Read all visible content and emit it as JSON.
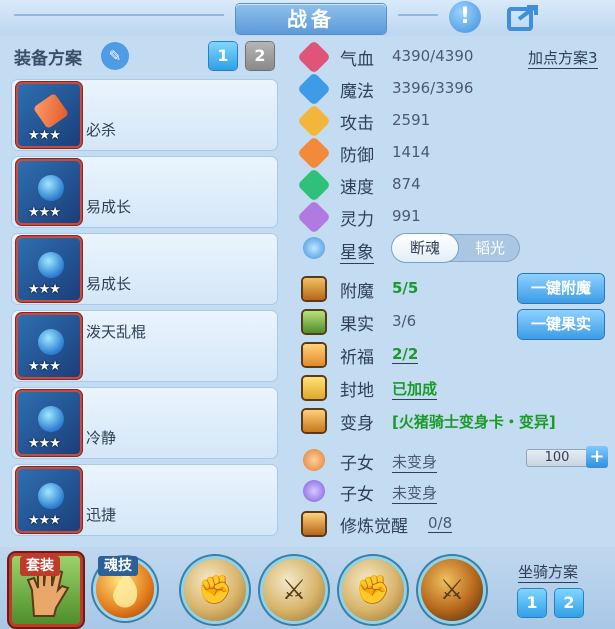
{
  "title": "战备",
  "left": {
    "plan_label": "装备方案",
    "plan_tabs": [
      "1",
      "2"
    ],
    "equipment": [
      {
        "name": "必杀",
        "stars": "★★★"
      },
      {
        "name": "易成长",
        "stars": "★★★"
      },
      {
        "name": "易成长",
        "stars": "★★★"
      },
      {
        "name": "泼天乱棍",
        "stars": "★★★"
      },
      {
        "name": "冷静",
        "stars": "★★★"
      },
      {
        "name": "迅捷",
        "stars": "★★★"
      }
    ]
  },
  "stats": {
    "points_plan": "加点方案3",
    "rows": [
      {
        "label": "气血",
        "value": "4390/4390",
        "color": "#e0547a",
        "icon": "heart-icon"
      },
      {
        "label": "魔法",
        "value": "3396/3396",
        "color": "#3e9be8",
        "icon": "shield-icon"
      },
      {
        "label": "攻击",
        "value": "2591",
        "color": "#f2b73a",
        "icon": "sword-icon"
      },
      {
        "label": "防御",
        "value": "1414",
        "color": "#f28a3a",
        "icon": "armor-icon"
      },
      {
        "label": "速度",
        "value": "874",
        "color": "#2fc07a",
        "icon": "lightning-icon"
      },
      {
        "label": "灵力",
        "value": "991",
        "color": "#b07be0",
        "icon": "spirit-icon"
      }
    ],
    "star_label": "星象",
    "star_options": [
      "断魂",
      "韬光"
    ]
  },
  "extras": [
    {
      "label": "附魔",
      "value": "5/5",
      "green": true,
      "button": "一键附魔"
    },
    {
      "label": "果实",
      "value": "3/6",
      "green": false,
      "button": "一键果实"
    },
    {
      "label": "祈福",
      "value": "2/2",
      "green": true
    },
    {
      "label": "封地",
      "value": "已加成",
      "green": true
    },
    {
      "label": "变身",
      "value": "[火猪骑士变身卡・变异]",
      "green": true
    },
    {
      "label": "子女",
      "value": "未变身",
      "quantity": "100"
    },
    {
      "label": "子女",
      "value": "未变身"
    },
    {
      "label": "修炼觉醒",
      "value": "0/8"
    }
  ],
  "bottom": {
    "set_label": "套装",
    "soul_label": "魂技",
    "mount_label": "坐骑方案",
    "mount_tabs": [
      "1",
      "2"
    ]
  }
}
